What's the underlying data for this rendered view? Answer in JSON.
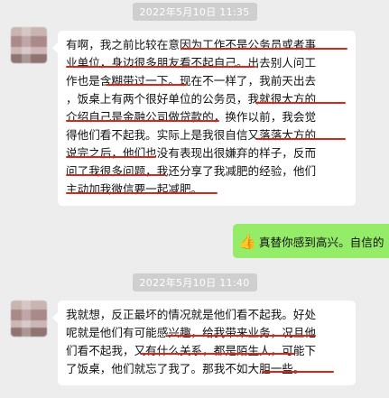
{
  "chat": {
    "timestamp_1": "2022年5月10日 11:35",
    "timestamp_2": "2022年5月10日 11:40",
    "message_1": "有啊，我之前比较在意因为工作不是公务员或者事\n业单位，身边很多朋友看不起自己。出去别人问工\n作也是含糊带过一下。现在不一样了，我前天出去\n，饭桌上有两个很好单位的公务员，我就很大方的\n介绍自己是金融公司做贷款的，换作以前，我会觉\n得他们看不起我。实际上是我很自信又落落大方的\n说完之后，他们也没有表现出很嫌弃的样子，反而\n问了我很多问题，我还分享了我减肥的经验，他们\n主动加我微信要一起减肥。",
    "reply_icon": "thumbs-up-emoji",
    "reply_text": "真替你感到高兴。自信的",
    "message_2": "我就想，反正最坏的情况就是他们看不起我。好处\n呢就是他们有可能感兴趣，给我带来业务，况且他\n们看不起我，又有什么关系，都是陌生人，可能下\n了饭桌，他们就忘了我了。那我不如大胆一些。"
  },
  "colors": {
    "background": "#ededed",
    "bubble_incoming": "#ffffff",
    "bubble_outgoing": "#95ec69",
    "underline": "#d6271c",
    "timestamp_bg": "#cfcfcf"
  }
}
